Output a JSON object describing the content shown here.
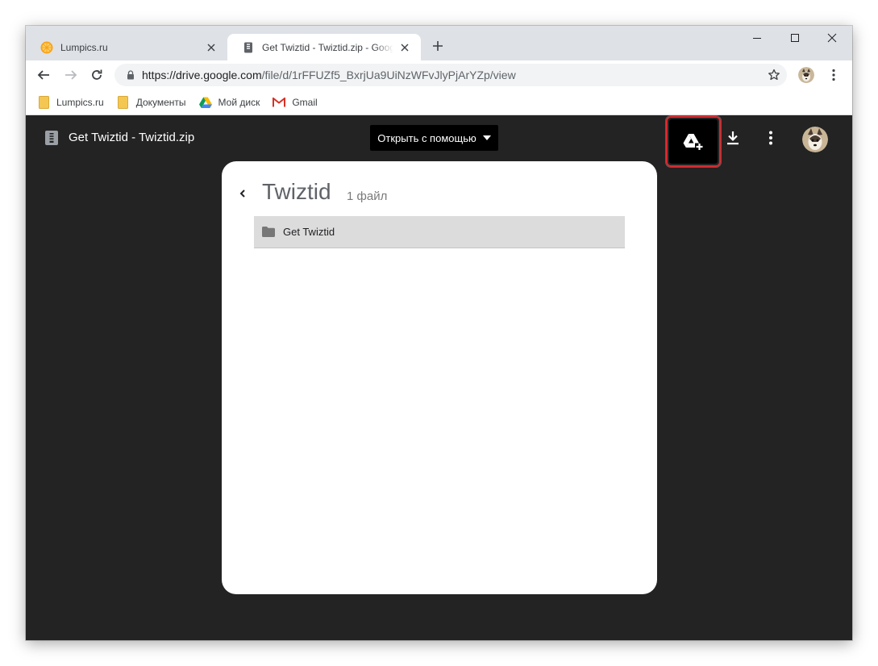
{
  "browser": {
    "tabs": [
      {
        "title": "Lumpics.ru",
        "active": false,
        "favicon": "orange-slice-icon"
      },
      {
        "title": "Get Twiztid - Twiztid.zip - Google Drive",
        "active": true,
        "favicon": "zip-file-icon"
      }
    ],
    "window_controls": [
      "minimize-icon",
      "maximize-icon",
      "close-icon"
    ],
    "address": {
      "host": "https://drive.google.com",
      "path": "/file/d/1rFFUZf5_BxrjUa9UiNzWFvJlyPjArYZp/view"
    },
    "bookmarks": [
      {
        "label": "Lumpics.ru",
        "icon": "folder-icon"
      },
      {
        "label": "Документы",
        "icon": "folder-icon"
      },
      {
        "label": "Мой диск",
        "icon": "google-drive-icon"
      },
      {
        "label": "Gmail",
        "icon": "gmail-icon"
      }
    ]
  },
  "viewer": {
    "file_title": "Get Twiztid - Twiztid.zip",
    "open_with_label": "Открыть с помощью",
    "actions": [
      "add-to-drive-icon",
      "download-icon",
      "more-vert-icon"
    ],
    "archive": {
      "name": "Twiztid",
      "count": "1 файл",
      "items": [
        {
          "name": "Get Twiztid",
          "type": "folder"
        }
      ]
    }
  },
  "colors": {
    "viewer_bg": "#232323",
    "highlight": "#e0262b",
    "tabstrip_bg": "#dee1e6",
    "row_bg": "#dcdcdc"
  }
}
